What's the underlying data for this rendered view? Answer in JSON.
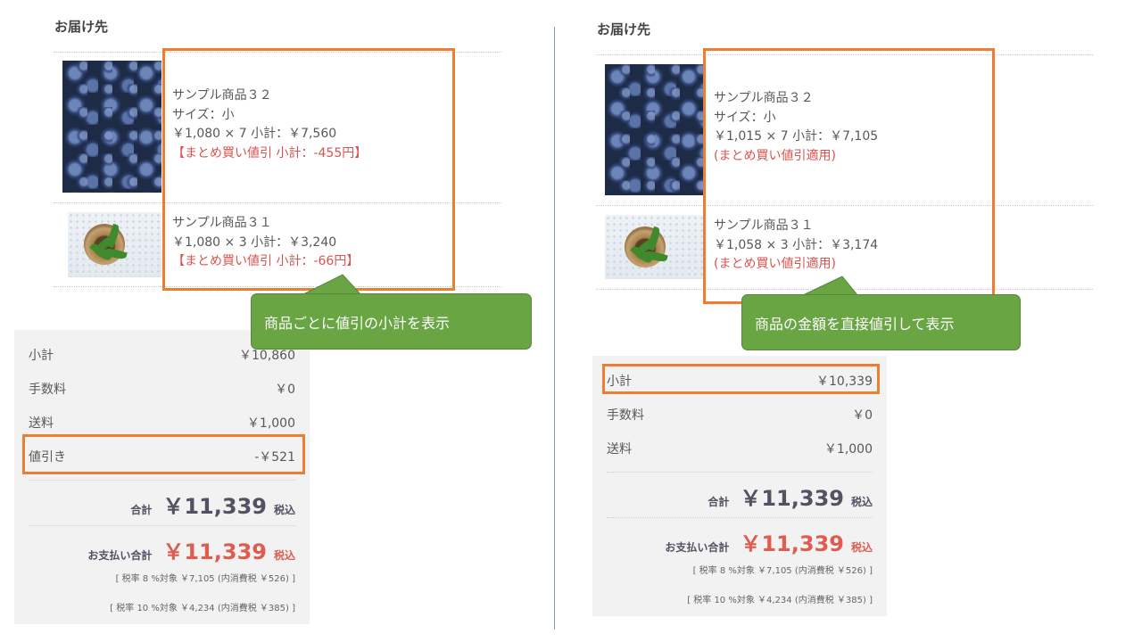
{
  "left": {
    "heading": "お届け先",
    "items": [
      {
        "name": "サンプル商品３２",
        "size": "サイズ：小",
        "price_line": "￥1,080 × 7  小計：￥7,560",
        "discount": "【まとめ買い値引 小計：-455円】"
      },
      {
        "name": "サンプル商品３１",
        "price_line": "￥1,080 × 3  小計：￥3,240",
        "discount": "【まとめ買い値引 小計：-66円】"
      }
    ],
    "callout": "商品ごとに値引の小計を表示",
    "summary": {
      "subtotal_label": "小計",
      "subtotal_value": "￥10,860",
      "fee_label": "手数料",
      "fee_value": "￥0",
      "shipping_label": "送料",
      "shipping_value": "￥1,000",
      "discount_label": "値引き",
      "discount_value": "-￥521",
      "total_label": "合計",
      "total_value": "￥11,339",
      "total_tax": "税込",
      "payment_label": "お支払い合計",
      "payment_value": "￥11,339",
      "payment_tax": "税込",
      "tax_note_8": "[ 税率 8 %対象  ￥7,105 (内消費税 ￥526) ]",
      "tax_note_10": "[ 税率 10 %対象  ￥4,234 (内消費税 ￥385) ]"
    }
  },
  "right": {
    "heading": "お届け先",
    "items": [
      {
        "name": "サンプル商品３２",
        "size": "サイズ：小",
        "price_line": "￥1,015 × 7  小計：￥7,105",
        "discount": "(まとめ買い値引適用)"
      },
      {
        "name": "サンプル商品３１",
        "price_line": "￥1,058 × 3  小計：￥3,174",
        "discount": "(まとめ買い値引適用)"
      }
    ],
    "callout": "商品の金額を直接値引して表示",
    "summary": {
      "subtotal_label": "小計",
      "subtotal_value": "￥10,339",
      "fee_label": "手数料",
      "fee_value": "￥0",
      "shipping_label": "送料",
      "shipping_value": "￥1,000",
      "total_label": "合計",
      "total_value": "￥11,339",
      "total_tax": "税込",
      "payment_label": "お支払い合計",
      "payment_value": "￥11,339",
      "payment_tax": "税込",
      "tax_note_8": "[ 税率 8 %対象  ￥7,105 (内消費税 ￥526) ]",
      "tax_note_10": "[ 税率 10 %対象  ￥4,234 (内消費税 ￥385) ]"
    }
  },
  "colors": {
    "highlight_box": "#ed7d31",
    "callout_bg": "#6aa544",
    "discount_text": "#d9534f",
    "payment_text": "#de5d50",
    "summary_bg": "#f2f2f2"
  },
  "icons": [
    "blueberries-image",
    "plant-pot-image"
  ]
}
